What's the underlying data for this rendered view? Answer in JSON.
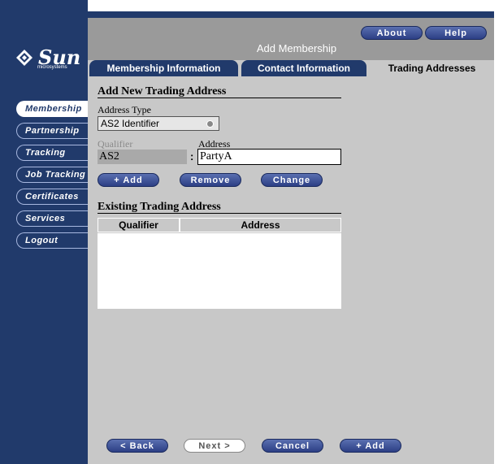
{
  "header": {
    "title": "Add Membership",
    "about_label": "About",
    "help_label": "Help"
  },
  "logo": {
    "name": "Sun",
    "tagline": "microsystems"
  },
  "sidebar": {
    "items": [
      {
        "label": "Membership",
        "active": true
      },
      {
        "label": "Partnership",
        "active": false
      },
      {
        "label": "Tracking",
        "active": false
      },
      {
        "label": "Job Tracking",
        "active": false
      },
      {
        "label": "Certificates",
        "active": false
      },
      {
        "label": "Services",
        "active": false
      },
      {
        "label": "Logout",
        "active": false
      }
    ]
  },
  "tabs": [
    {
      "label": "Membership Information",
      "active": false
    },
    {
      "label": "Contact Information",
      "active": false
    },
    {
      "label": "Trading Addresses",
      "active": true
    }
  ],
  "form": {
    "section_title": "Add New Trading Address",
    "address_type_label": "Address Type",
    "address_type_value": "AS2 Identifier",
    "qualifier_label": "Qualifier",
    "qualifier_value": "AS2",
    "address_label": "Address",
    "address_value": "PartyA",
    "separator": ":",
    "add_label": "+ Add",
    "remove_label": "Remove",
    "change_label": "Change"
  },
  "existing": {
    "section_title": "Existing Trading Address",
    "columns": [
      "Qualifier",
      "Address"
    ],
    "rows": []
  },
  "footer": {
    "back_label": "< Back",
    "next_label": "Next >",
    "cancel_label": "Cancel",
    "add_label": "+ Add"
  },
  "colors": {
    "navy": "#213a6b",
    "panel_gray": "#c8c8c8",
    "header_gray": "#9a9a9a",
    "button_blue": "#2c3f85"
  }
}
